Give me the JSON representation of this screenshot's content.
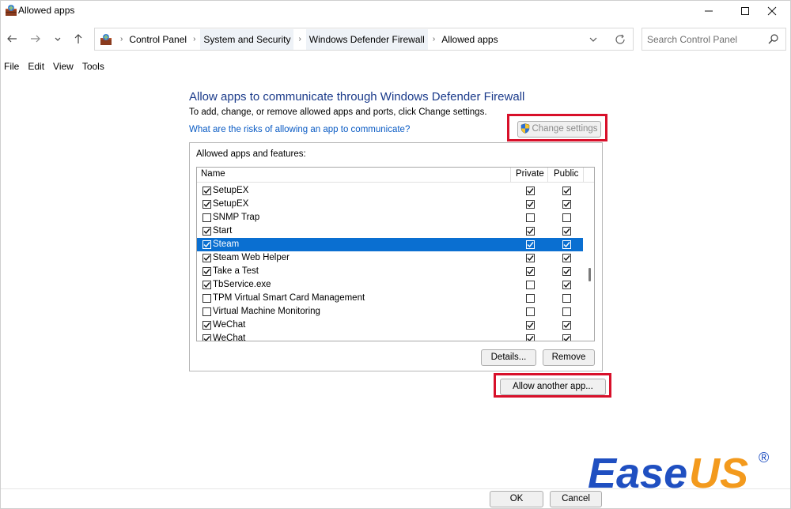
{
  "window": {
    "title": "Allowed apps"
  },
  "address": {
    "crumbs": [
      "Control Panel",
      "System and Security",
      "Windows Defender Firewall",
      "Allowed apps"
    ]
  },
  "search": {
    "placeholder": "Search Control Panel"
  },
  "menu": {
    "file": "File",
    "edit": "Edit",
    "view": "View",
    "tools": "Tools"
  },
  "content": {
    "heading": "Allow apps to communicate through Windows Defender Firewall",
    "subtext": "To add, change, or remove allowed apps and ports, click Change settings.",
    "risk_link": "What are the risks of allowing an app to communicate?",
    "change_settings_label": "Change settings",
    "group_label": "Allowed apps and features:",
    "columns": {
      "name": "Name",
      "private": "Private",
      "public": "Public"
    },
    "rows": [
      {
        "name": "SetupEX",
        "enabled": true,
        "private": true,
        "public": true,
        "selected": false
      },
      {
        "name": "SetupEX",
        "enabled": true,
        "private": true,
        "public": true,
        "selected": false
      },
      {
        "name": "SNMP Trap",
        "enabled": false,
        "private": false,
        "public": false,
        "selected": false
      },
      {
        "name": "Start",
        "enabled": true,
        "private": true,
        "public": true,
        "selected": false
      },
      {
        "name": "Steam",
        "enabled": true,
        "private": true,
        "public": true,
        "selected": true
      },
      {
        "name": "Steam Web Helper",
        "enabled": true,
        "private": true,
        "public": true,
        "selected": false
      },
      {
        "name": "Take a Test",
        "enabled": true,
        "private": true,
        "public": true,
        "selected": false
      },
      {
        "name": "TbService.exe",
        "enabled": true,
        "private": false,
        "public": true,
        "selected": false
      },
      {
        "name": "TPM Virtual Smart Card Management",
        "enabled": false,
        "private": false,
        "public": false,
        "selected": false
      },
      {
        "name": "Virtual Machine Monitoring",
        "enabled": false,
        "private": false,
        "public": false,
        "selected": false
      },
      {
        "name": "WeChat",
        "enabled": true,
        "private": true,
        "public": true,
        "selected": false
      },
      {
        "name": "WeChat",
        "enabled": true,
        "private": true,
        "public": true,
        "selected": false
      }
    ],
    "details_label": "Details...",
    "remove_label": "Remove",
    "allow_another_label": "Allow another app..."
  },
  "footer": {
    "ok_label": "OK",
    "cancel_label": "Cancel"
  },
  "logo": {
    "text_ease": "Ease",
    "text_us": "US",
    "reg": "®"
  },
  "colors": {
    "heading": "#1a3a8a",
    "link": "#0a5bc4",
    "selection": "#0a6fd1",
    "highlight_box": "#d8102a",
    "logo_blue": "#1f4fc1",
    "logo_orange": "#f39a1d"
  }
}
